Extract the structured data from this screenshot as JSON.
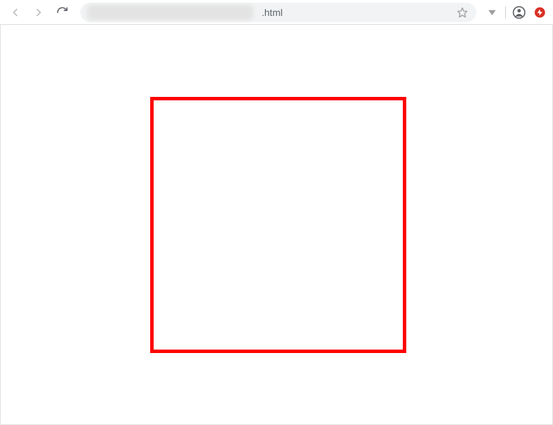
{
  "toolbar": {
    "url_visible_suffix": ".html"
  },
  "page": {
    "box": {
      "border_color": "red"
    }
  }
}
